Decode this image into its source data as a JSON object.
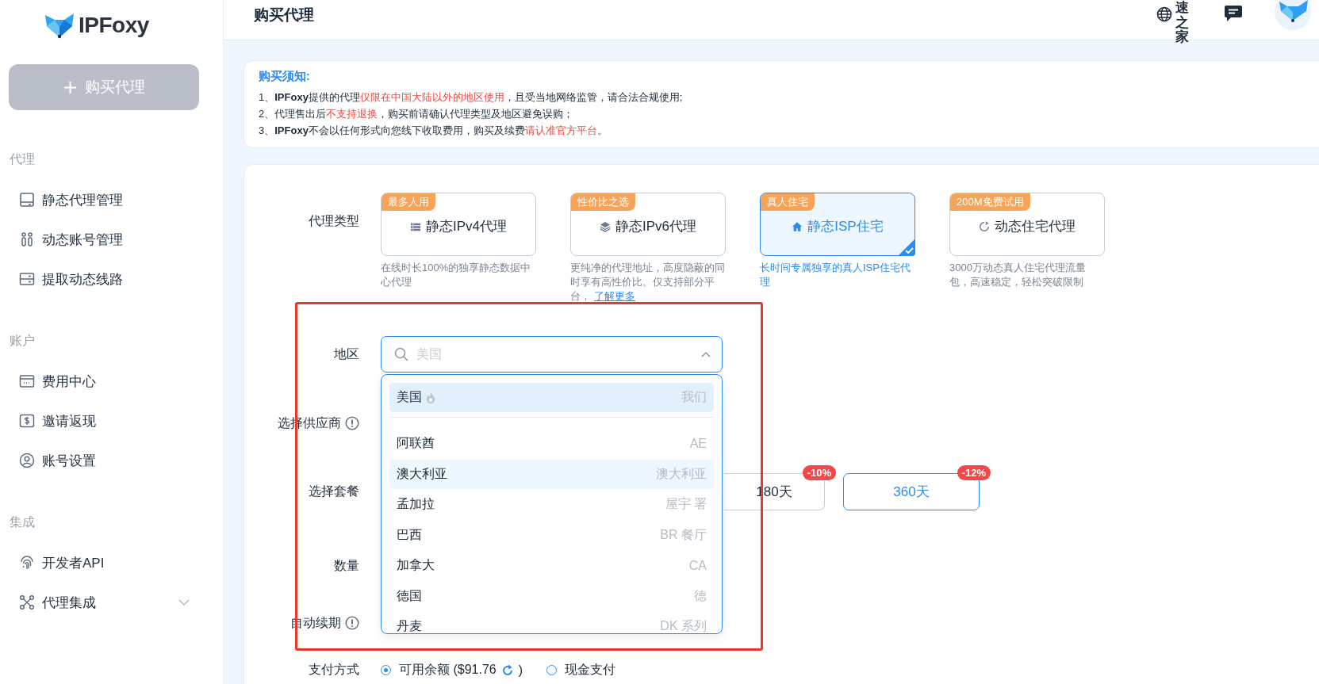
{
  "sidebar": {
    "logo": "IPFoxy",
    "buy_button": "购买代理",
    "sections": [
      {
        "title": "代理",
        "items": [
          {
            "label": "静态代理管理",
            "kind": "link"
          },
          {
            "label": "动态账号管理",
            "kind": "link"
          },
          {
            "label": "提取动态线路",
            "kind": "link"
          }
        ]
      },
      {
        "title": "账户",
        "items": [
          {
            "label": "费用中心",
            "kind": "link"
          },
          {
            "label": "邀请返现",
            "kind": "link"
          },
          {
            "label": "账号设置",
            "kind": "link"
          }
        ]
      },
      {
        "title": "集成",
        "items": [
          {
            "label": "开发者API",
            "kind": "link"
          },
          {
            "label": "代理集成",
            "kind": "group",
            "expanded": false
          }
        ]
      }
    ]
  },
  "header": {
    "title": "购买代理",
    "user_name": "速之家"
  },
  "notice": {
    "title": "购买须知:",
    "lines": [
      [
        {
          "text": "1、**IPFoxy**提供的代理",
          "highlight": false
        },
        {
          "text": "仅限在中国大陆以外的地区使用",
          "highlight": true
        },
        {
          "text": "，且受当地网络监管，请合法合规使用;",
          "highlight": false
        }
      ],
      [
        {
          "text": "2、代理售出后",
          "highlight": false
        },
        {
          "text": "不支持退换",
          "highlight": true
        },
        {
          "text": "，购买前请确认代理类型及地区避免误购；",
          "highlight": false
        }
      ],
      [
        {
          "text": "3、**IPFoxy**不会以任何形式向您线下收取费用，购买及续费",
          "highlight": false
        },
        {
          "text": "请认准官方平台",
          "highlight": true
        },
        {
          "text": "。",
          "highlight": false
        }
      ]
    ]
  },
  "proxy_type": {
    "label": "代理类型",
    "options": [
      {
        "badge": "最多人用",
        "title": "静态IPv4代理",
        "description": "在线时长100%的独享静态数据中心代理",
        "selected": false
      },
      {
        "badge": "性价比之选",
        "title": "静态IPv6代理",
        "description": "更纯净的代理地址，高度隐蔽的同时享有高性价比。仅支持部分平台，",
        "link": "了解更多",
        "selected": false
      },
      {
        "badge": "真人住宅",
        "title": "静态ISP住宅",
        "description": "长时间专属独享的真人ISP住宅代理",
        "selected": true
      },
      {
        "badge": "200M免费试用",
        "title": "动态住宅代理",
        "description": "3000万动态真人住宅代理流量包，高速稳定，轻松突破限制",
        "selected": false
      }
    ]
  },
  "region": {
    "label": "地区",
    "placeholder": "美国",
    "expanded": true,
    "options": [
      {
        "name": "美国",
        "code": "我们",
        "hot": true,
        "selected": true,
        "highlighted": false
      },
      {
        "name": "阿联酋",
        "code": "AE",
        "hot": false,
        "selected": false,
        "highlighted": false
      },
      {
        "name": "澳大利亚",
        "code": "澳大利亚",
        "hot": false,
        "selected": false,
        "highlighted": true
      },
      {
        "name": "孟加拉",
        "code": "屋宇 署",
        "hot": false,
        "selected": false,
        "highlighted": false
      },
      {
        "name": "巴西",
        "code": "BR 餐厅",
        "hot": false,
        "selected": false,
        "highlighted": false
      },
      {
        "name": "加拿大",
        "code": "CA",
        "hot": false,
        "selected": false,
        "highlighted": false
      },
      {
        "name": "德国",
        "code": "德",
        "hot": false,
        "selected": false,
        "highlighted": false
      },
      {
        "name": "丹麦",
        "code": "DK 系列",
        "hot": false,
        "selected": false,
        "highlighted": false
      }
    ]
  },
  "supplier": {
    "label": "选择供应商",
    "info_icon": true
  },
  "package": {
    "label": "选择套餐",
    "options": [
      {
        "label": "180天",
        "discount": "-10%",
        "selected": false
      },
      {
        "label": "360天",
        "discount": "-12%",
        "selected": true
      }
    ]
  },
  "quantity": {
    "label": "数量"
  },
  "auto_renew": {
    "label": "自动续期",
    "info_icon": true
  },
  "payment": {
    "label": "支付方式",
    "options": [
      {
        "label": "可用余额 ($91.76",
        "closing": ")",
        "refresh": true,
        "selected": true
      },
      {
        "label": "现金支付",
        "refresh": false,
        "selected": false
      }
    ]
  }
}
